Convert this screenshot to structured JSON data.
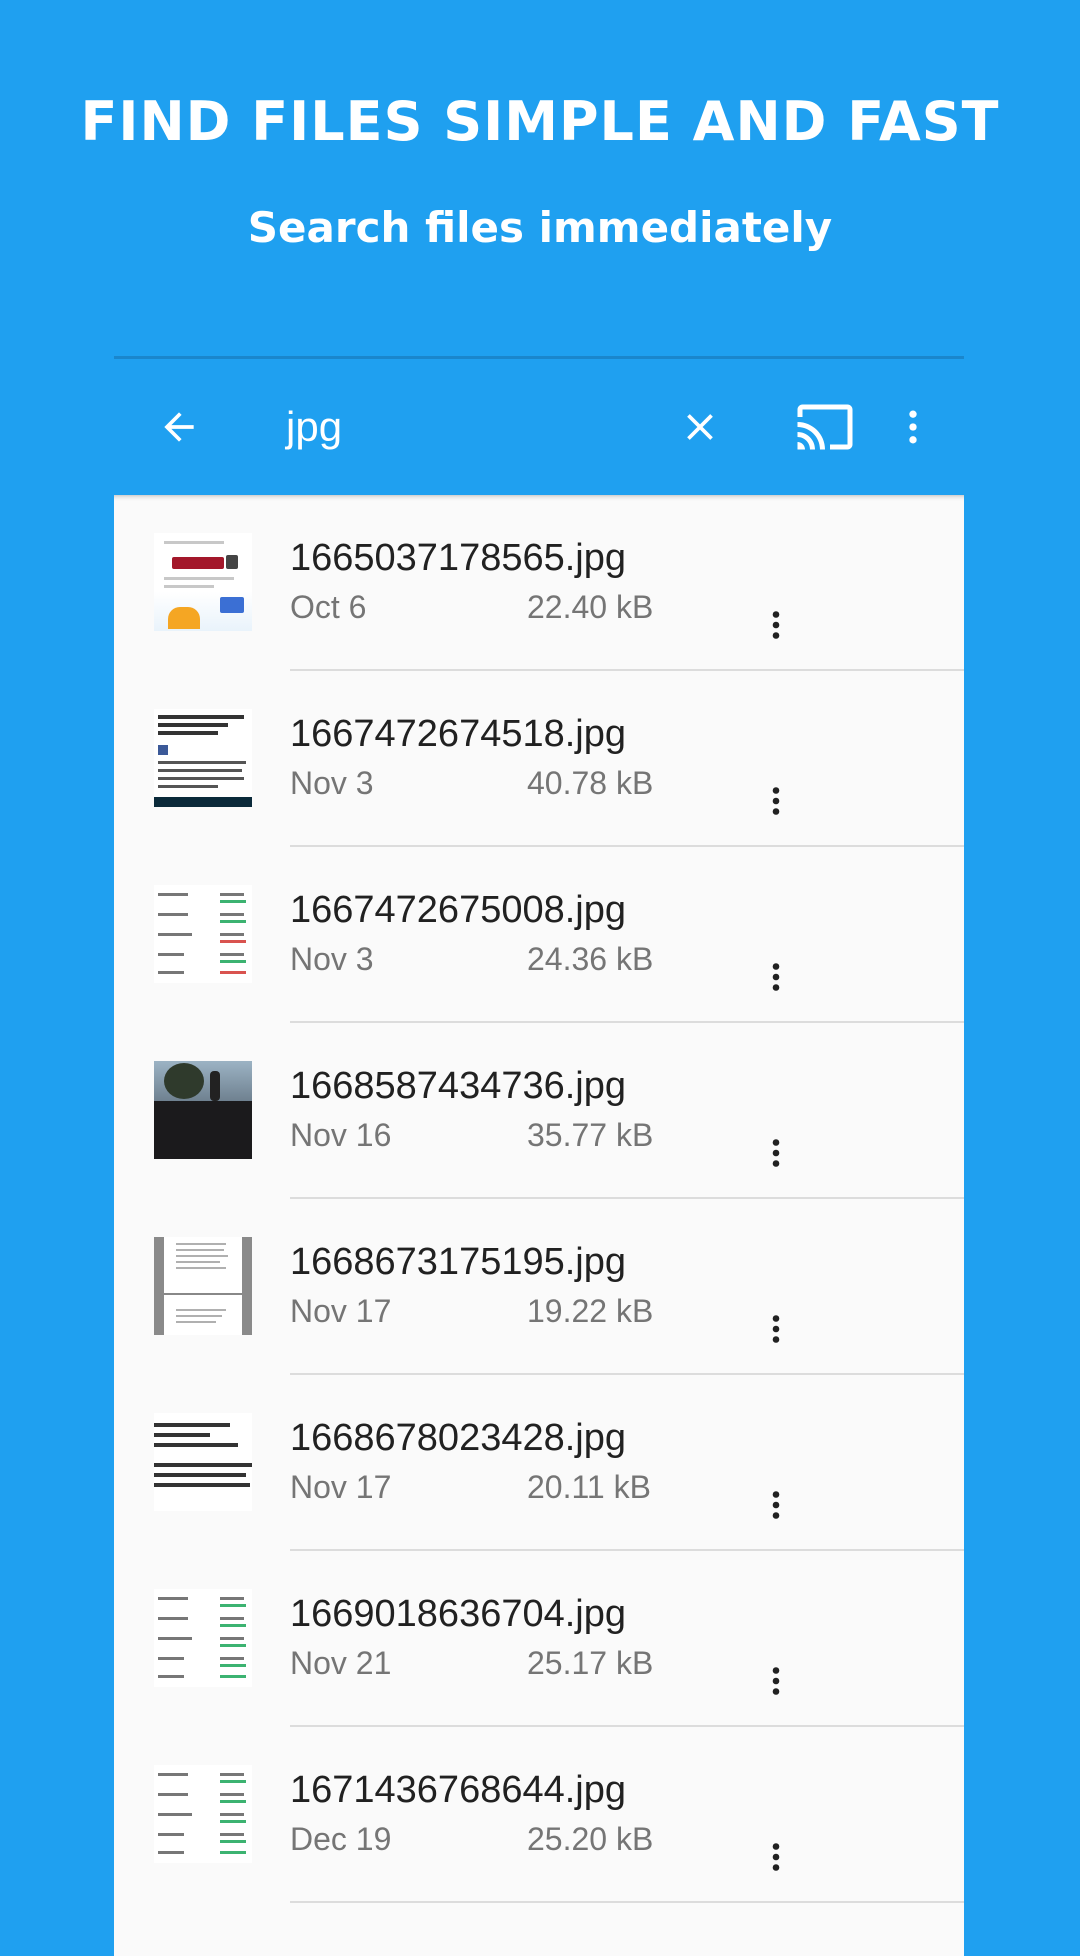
{
  "promo": {
    "title": "FIND FILES SIMPLE AND FAST",
    "subtitle": "Search files immediately"
  },
  "toolbar": {
    "search_value": "jpg",
    "icons": [
      "back-arrow-icon",
      "close-icon",
      "cast-icon",
      "more-vert-icon"
    ]
  },
  "files": [
    {
      "name": "1665037178565.jpg",
      "date": "Oct 6",
      "size": "22.40 kB"
    },
    {
      "name": "1667472674518.jpg",
      "date": "Nov 3",
      "size": "40.78 kB"
    },
    {
      "name": "1667472675008.jpg",
      "date": "Nov 3",
      "size": "24.36 kB"
    },
    {
      "name": "1668587434736.jpg",
      "date": "Nov 16",
      "size": "35.77 kB"
    },
    {
      "name": "1668673175195.jpg",
      "date": "Nov 17",
      "size": "19.22 kB"
    },
    {
      "name": "1668678023428.jpg",
      "date": "Nov 17",
      "size": "20.11 kB"
    },
    {
      "name": "1669018636704.jpg",
      "date": "Nov 21",
      "size": "25.17 kB"
    },
    {
      "name": "1671436768644.jpg",
      "date": "Dec 19",
      "size": "25.20 kB"
    }
  ],
  "colors": {
    "background": "#1fa0f0",
    "list_background": "#fafafa",
    "primary_text": "#212121",
    "secondary_text": "#757575"
  }
}
